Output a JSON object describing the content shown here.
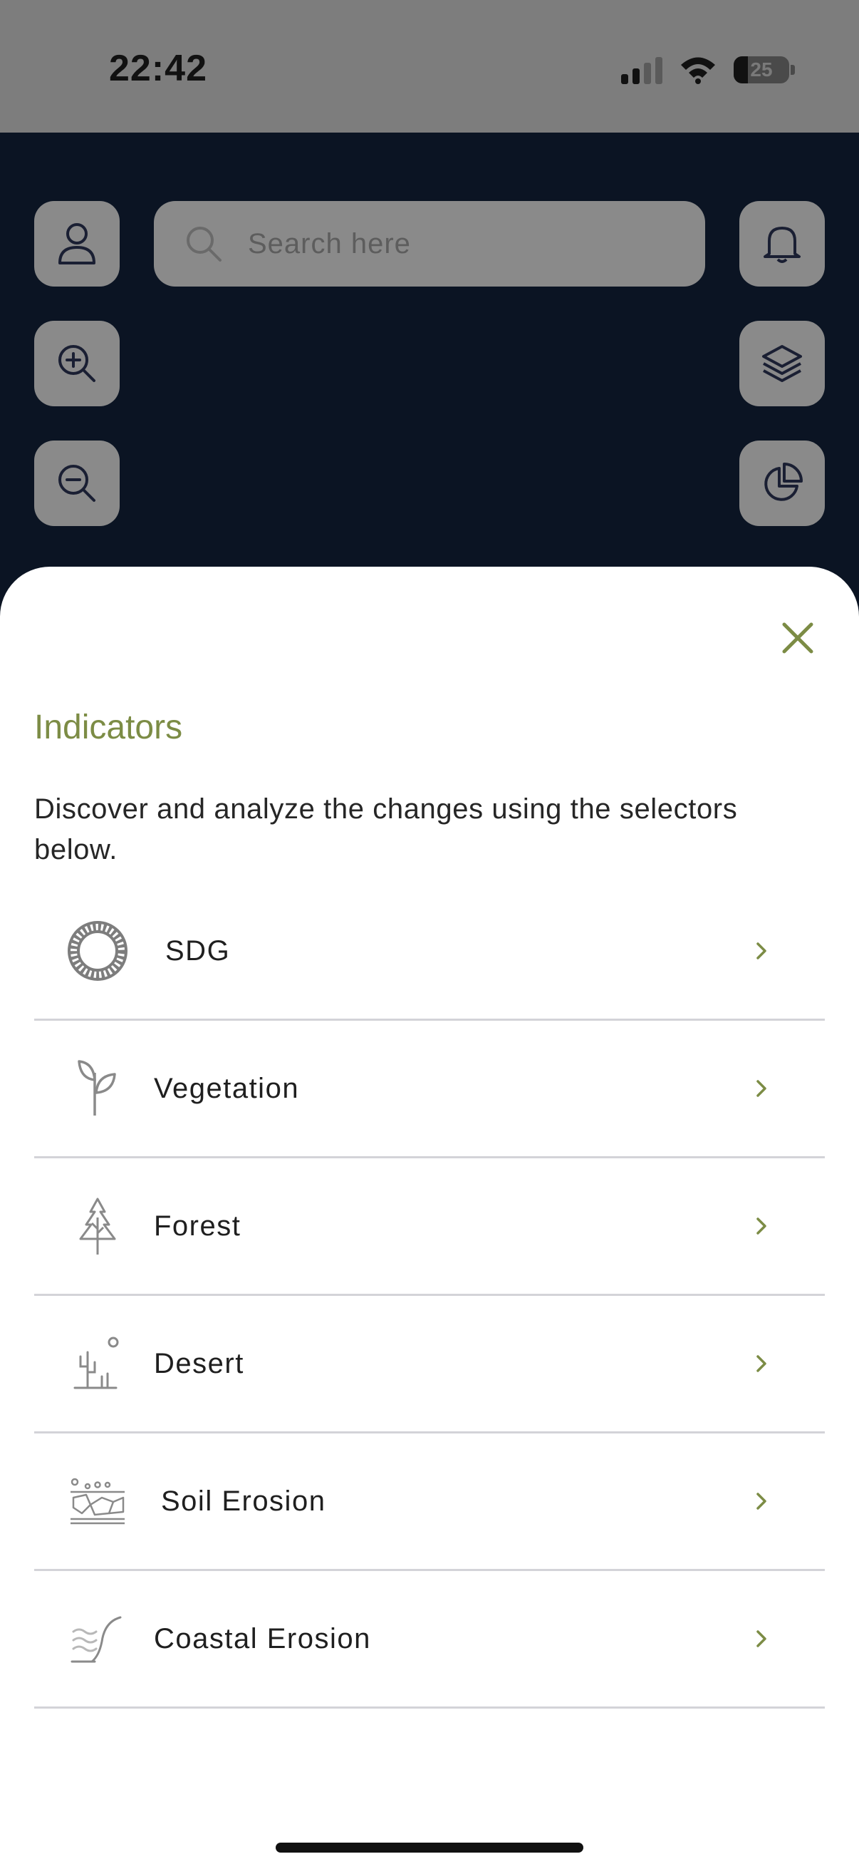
{
  "status_bar": {
    "time": "22:42",
    "battery_level": "25",
    "icons": [
      "cellular-signal-icon",
      "wifi-icon",
      "battery-icon"
    ]
  },
  "map_controls": {
    "search": {
      "placeholder": "Search here"
    },
    "left_buttons": [
      "profile-icon",
      "zoom-in-icon",
      "zoom-out-icon"
    ],
    "right_buttons": [
      "bell-icon",
      "layers-icon",
      "pie-chart-icon"
    ]
  },
  "sheet": {
    "title": "Indicators",
    "description": "Discover and analyze the changes using the selectors below.",
    "items": [
      {
        "label": "SDG",
        "icon": "sdg-wheel-icon"
      },
      {
        "label": "Vegetation",
        "icon": "sprout-icon"
      },
      {
        "label": "Forest",
        "icon": "tree-icon"
      },
      {
        "label": "Desert",
        "icon": "cactus-icon"
      },
      {
        "label": "Soil Erosion",
        "icon": "soil-erosion-icon"
      },
      {
        "label": "Coastal Erosion",
        "icon": "coastal-erosion-icon"
      }
    ]
  },
  "colors": {
    "accent": "#7c8c45",
    "overlay": "#8a8a8a",
    "map_background": "#0b1423"
  }
}
